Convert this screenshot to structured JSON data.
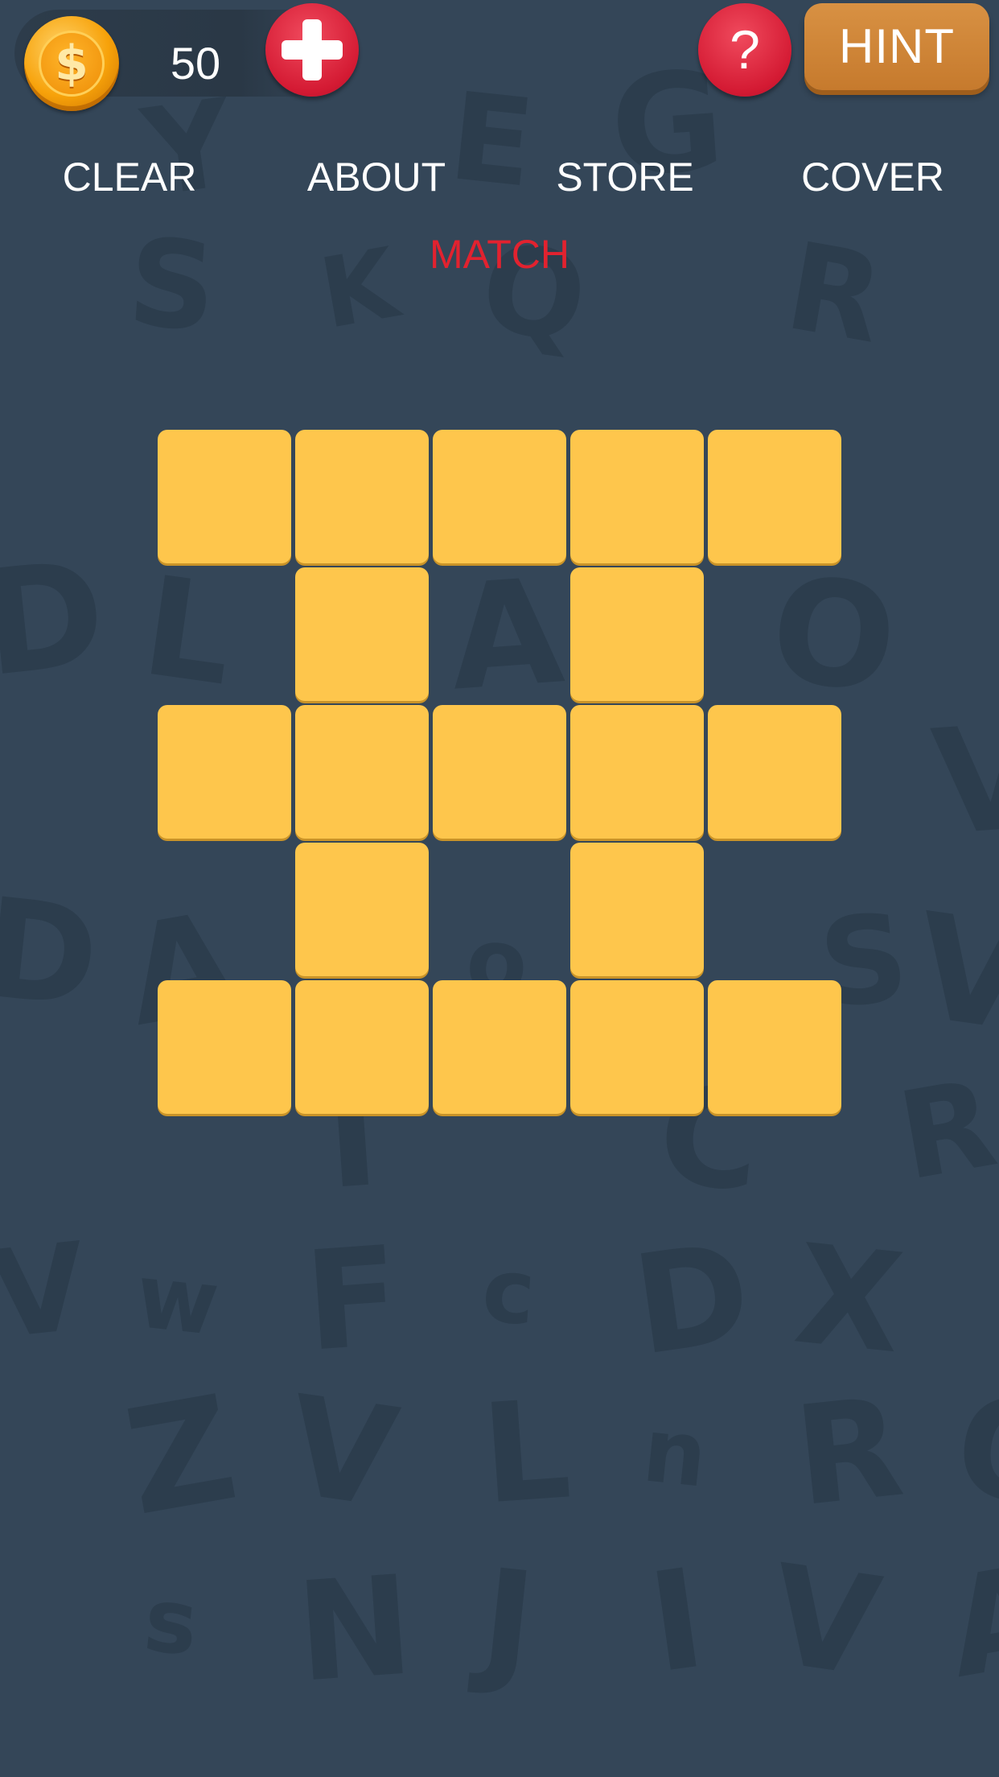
{
  "hud": {
    "coin_icon": "dollar-coin-icon",
    "coin_symbol": "$",
    "coins": "50",
    "add_coins_icon": "plus-icon",
    "help_label": "?",
    "hint_label": "HINT"
  },
  "menu": {
    "items": [
      {
        "label": "CLEAR"
      },
      {
        "label": "ABOUT"
      },
      {
        "label": "STORE"
      },
      {
        "label": "COVER"
      }
    ]
  },
  "game": {
    "mode_label": "MATCH",
    "board_rows": 5,
    "board_cols": 5,
    "tiles": [
      [
        1,
        1,
        1,
        1,
        1
      ],
      [
        0,
        1,
        0,
        1,
        0
      ],
      [
        1,
        1,
        1,
        1,
        1
      ],
      [
        0,
        1,
        0,
        1,
        0
      ],
      [
        1,
        1,
        1,
        1,
        1
      ]
    ]
  },
  "colors": {
    "background": "#344658",
    "tile": "#fec64c",
    "mode_label": "#e2222f",
    "hint_button": "#d08637",
    "help_button": "#d41a33"
  }
}
